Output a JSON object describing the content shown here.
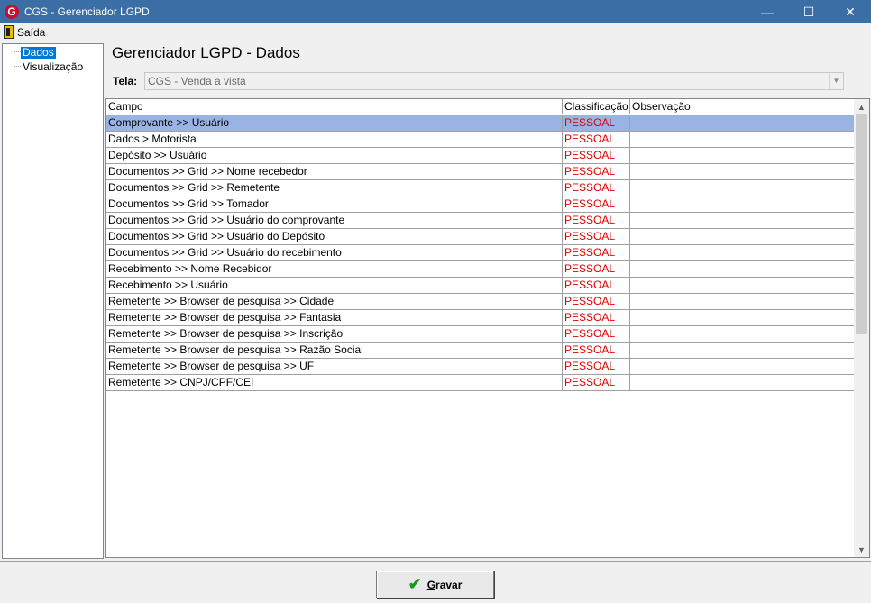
{
  "window": {
    "title": "CGS - Gerenciador LGPD",
    "icon_letter": "G"
  },
  "menu": {
    "exit_label": "Saída"
  },
  "tree": {
    "items": [
      {
        "label": "Dados",
        "selected": true
      },
      {
        "label": "Visualização",
        "selected": false
      }
    ]
  },
  "main": {
    "heading": "Gerenciador LGPD - Dados",
    "tela_label": "Tela:",
    "tela_value": "CGS - Venda a vista"
  },
  "grid": {
    "columns": [
      "Campo",
      "Classificação",
      "Observação"
    ],
    "rows": [
      {
        "campo": "Comprovante >> Usuário",
        "classificacao": "PESSOAL",
        "observacao": ""
      },
      {
        "campo": "Dados > Motorista",
        "classificacao": "PESSOAL",
        "observacao": ""
      },
      {
        "campo": "Depósito >> Usuário",
        "classificacao": "PESSOAL",
        "observacao": ""
      },
      {
        "campo": "Documentos >> Grid >> Nome recebedor",
        "classificacao": "PESSOAL",
        "observacao": ""
      },
      {
        "campo": "Documentos >> Grid >> Remetente",
        "classificacao": "PESSOAL",
        "observacao": ""
      },
      {
        "campo": "Documentos >> Grid >> Tomador",
        "classificacao": "PESSOAL",
        "observacao": ""
      },
      {
        "campo": "Documentos >> Grid >> Usuário do comprovante",
        "classificacao": "PESSOAL",
        "observacao": ""
      },
      {
        "campo": "Documentos >> Grid >> Usuário do Depósito",
        "classificacao": "PESSOAL",
        "observacao": ""
      },
      {
        "campo": "Documentos >> Grid >> Usuário do recebimento",
        "classificacao": "PESSOAL",
        "observacao": ""
      },
      {
        "campo": "Recebimento >> Nome Recebidor",
        "classificacao": "PESSOAL",
        "observacao": ""
      },
      {
        "campo": "Recebimento >> Usuário",
        "classificacao": "PESSOAL",
        "observacao": ""
      },
      {
        "campo": "Remetente >> Browser de pesquisa >> Cidade",
        "classificacao": "PESSOAL",
        "observacao": ""
      },
      {
        "campo": "Remetente >> Browser de pesquisa >> Fantasia",
        "classificacao": "PESSOAL",
        "observacao": ""
      },
      {
        "campo": "Remetente >> Browser de pesquisa >> Inscrição",
        "classificacao": "PESSOAL",
        "observacao": ""
      },
      {
        "campo": "Remetente >> Browser de pesquisa >> Razão Social",
        "classificacao": "PESSOAL",
        "observacao": ""
      },
      {
        "campo": "Remetente >> Browser de pesquisa >> UF",
        "classificacao": "PESSOAL",
        "observacao": ""
      },
      {
        "campo": "Remetente >> CNPJ/CPF/CEI",
        "classificacao": "PESSOAL",
        "observacao": ""
      }
    ],
    "selected_row": 0
  },
  "footer": {
    "save_label": "Gravar",
    "save_mnemonic": "G",
    "save_rest": "ravar"
  },
  "colors": {
    "titlebar": "#3a6ea5",
    "selection": "#99b4e4",
    "classification_text": "#e00000",
    "save_icon": "#1a9a1a"
  }
}
